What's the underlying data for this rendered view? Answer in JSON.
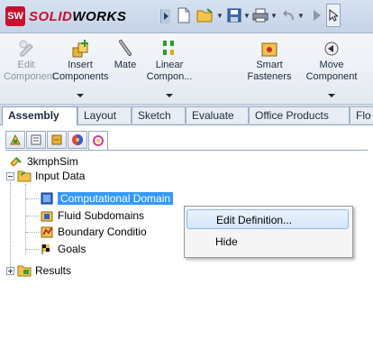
{
  "app": {
    "logo_badge": "SW",
    "brand_bold": "SOLID",
    "brand_rest": "WORKS"
  },
  "ribbon": {
    "buttons": [
      {
        "line1": "Edit",
        "line2": "Component",
        "icon": "edit-component-icon",
        "enabled": false
      },
      {
        "line1": "Insert",
        "line2": "Components",
        "icon": "insert-components-icon",
        "enabled": true
      },
      {
        "line1": "Mate",
        "line2": "",
        "icon": "mate-icon",
        "enabled": true
      },
      {
        "line1": "Linear",
        "line2": "Compon...",
        "icon": "linear-pattern-icon",
        "enabled": true
      },
      {
        "line1": "Smart",
        "line2": "Fasteners",
        "icon": "smart-fasteners-icon",
        "enabled": true
      },
      {
        "line1": "Move",
        "line2": "Component",
        "icon": "move-component-icon",
        "enabled": true
      }
    ]
  },
  "tabs": [
    "Assembly",
    "Layout",
    "Sketch",
    "Evaluate",
    "Office Products",
    "Flo"
  ],
  "active_tab": "Assembly",
  "tree": {
    "root": "3kmphSim",
    "input_data": "Input Data",
    "children": [
      "Computational Domain",
      "Fluid Subdomains",
      "Boundary Conditio",
      "Goals"
    ],
    "results": "Results"
  },
  "context_menu": {
    "items": [
      "Edit Definition...",
      "Hide"
    ],
    "highlighted": "Edit Definition..."
  },
  "colors": {
    "selection": "#3399ff",
    "brand_red": "#c8102e",
    "menu_highlight": "#d3e6fb"
  }
}
